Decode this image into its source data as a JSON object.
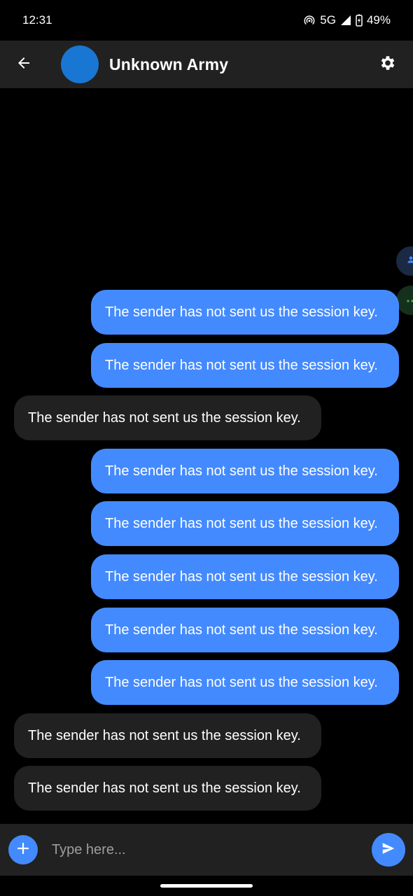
{
  "status_bar": {
    "time": "12:31",
    "network": "5G",
    "battery": "49%"
  },
  "header": {
    "title": "Unknown Army",
    "avatar_color": "#1976d2",
    "icons": [
      "back-arrow-icon",
      "gear-icon"
    ]
  },
  "messages": [
    {
      "direction": "out",
      "text": "The sender has not sent us the session key."
    },
    {
      "direction": "out",
      "text": "The sender has not sent us the session key."
    },
    {
      "direction": "in",
      "text": "The sender has not sent us the session key."
    },
    {
      "direction": "out",
      "text": "The sender has not sent us the session key."
    },
    {
      "direction": "out",
      "text": "The sender has not sent us the session key."
    },
    {
      "direction": "out",
      "text": "The sender has not sent us the session key."
    },
    {
      "direction": "out",
      "text": "The sender has not sent us the session key."
    },
    {
      "direction": "out",
      "text": "The sender has not sent us the session key."
    },
    {
      "direction": "in",
      "text": "The sender has not sent us the session key."
    },
    {
      "direction": "in",
      "text": "The sender has not sent us the session key."
    }
  ],
  "composer": {
    "placeholder": "Type here...",
    "value": ""
  },
  "colors": {
    "outgoing_bubble": "#448aff",
    "incoming_bubble": "#212121",
    "header_bg": "#212121",
    "background": "#000000"
  }
}
